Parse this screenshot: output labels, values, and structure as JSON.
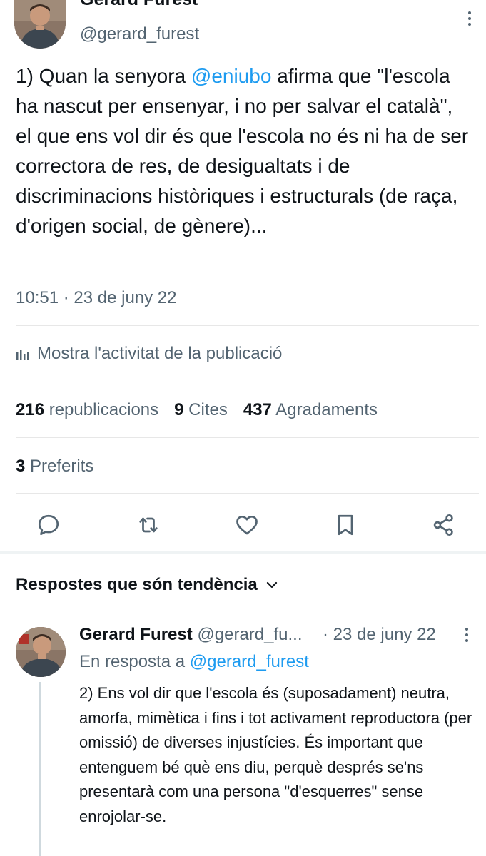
{
  "tweet": {
    "author_name": "Gerard Furest",
    "handle": "@gerard_furest",
    "text_1": "1) Quan la senyora ",
    "mention": "@eniubo",
    "text_2": " afirma que \"l'escola ha nascut per ensenyar, i no per salvar el català\", el que ens vol dir és que l'escola no és ni ha de ser correctora de res, de desigualtats i de discriminacions històriques i estructurals (de raça, d'origen social, de gènere)...",
    "time": "10:51 · 23 de juny 22"
  },
  "activity": {
    "label": "Mostra l'activitat de la publicació",
    "icon": "analytics-icon"
  },
  "stats": {
    "reposts_count": "216",
    "reposts_label": "republicacions",
    "quotes_count": "9",
    "quotes_label": "Cites",
    "likes_count": "437",
    "likes_label": "Agradaments",
    "bookmarks_count": "3",
    "bookmarks_label": "Preferits"
  },
  "actions": [
    "reply-icon",
    "repost-icon",
    "like-icon",
    "bookmark-icon",
    "share-icon"
  ],
  "replies_section": {
    "label": "Respostes que són tendència"
  },
  "reply": {
    "author_name": "Gerard Furest",
    "handle": "@gerard_fu...",
    "date": "· 23 de juny 22",
    "replying_prefix": "En resposta a",
    "replying_handle": "@gerard_furest",
    "text": "2) Ens vol dir que l'escola és (suposadament) neutra, amorfa, mimètica i fins i tot activament reproductora (per omissió) de diverses injustícies. És important que entenguem bé què ens diu, perquè després se'ns presentarà com una persona \"d'esquerres\" sense enrojolar-se."
  },
  "colors": {
    "accent": "#1d9bf0",
    "text": "#0f1419",
    "secondary": "#536471",
    "divider": "#e7e7e7"
  }
}
